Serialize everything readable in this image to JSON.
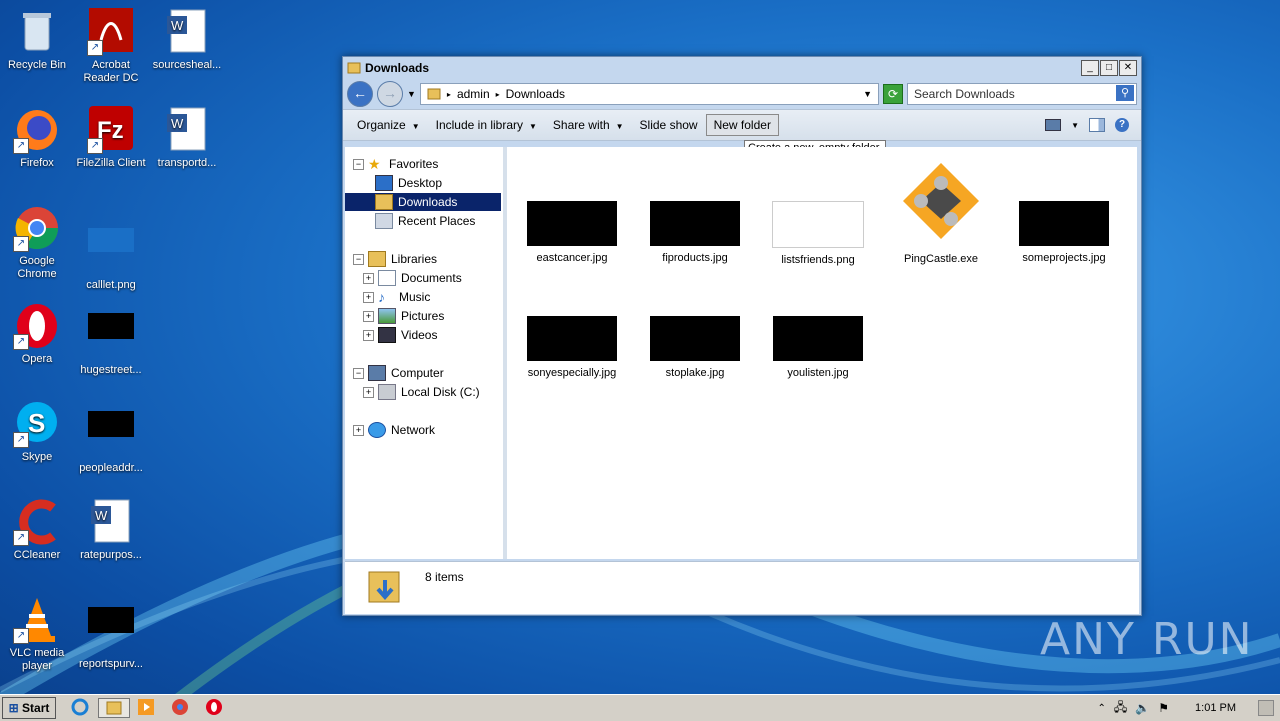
{
  "desktop": {
    "icons": [
      {
        "label": "Recycle Bin"
      },
      {
        "label": "Acrobat Reader DC"
      },
      {
        "label": "sourcesheal..."
      },
      {
        "label": "Firefox"
      },
      {
        "label": "FileZilla Client"
      },
      {
        "label": "transportd..."
      },
      {
        "label": "Google Chrome"
      },
      {
        "label": "calllet.png"
      },
      {
        "label": "Opera"
      },
      {
        "label": "hugestreet..."
      },
      {
        "label": "Skype"
      },
      {
        "label": "peopleaddr..."
      },
      {
        "label": "CCleaner"
      },
      {
        "label": "ratepurpos..."
      },
      {
        "label": "VLC media player"
      },
      {
        "label": "reportspurv..."
      }
    ]
  },
  "window": {
    "title": "Downloads",
    "breadcrumb": [
      "admin",
      "Downloads"
    ],
    "search_placeholder": "Search Downloads",
    "toolbar": {
      "organize": "Organize",
      "include": "Include in library",
      "share": "Share with",
      "slideshow": "Slide show",
      "newfolder": "New folder"
    },
    "tooltip": "Create a new, empty folder.",
    "nav": {
      "favorites": "Favorites",
      "desktop": "Desktop",
      "downloads": "Downloads",
      "recent": "Recent Places",
      "libraries": "Libraries",
      "documents": "Documents",
      "music": "Music",
      "pictures": "Pictures",
      "videos": "Videos",
      "computer": "Computer",
      "localdisk": "Local Disk (C:)",
      "network": "Network"
    },
    "files": [
      {
        "name": "eastcancer.jpg"
      },
      {
        "name": "fiproducts.jpg"
      },
      {
        "name": "listsfriends.png"
      },
      {
        "name": "PingCastle.exe"
      },
      {
        "name": "someprojects.jpg"
      },
      {
        "name": "sonyespecially.jpg"
      },
      {
        "name": "stoplake.jpg"
      },
      {
        "name": "youlisten.jpg"
      }
    ],
    "status": "8 items"
  },
  "taskbar": {
    "start": "Start",
    "clock": "1:01 PM"
  },
  "watermark": "ANY RUN",
  "colors": {
    "selection": "#0a246a",
    "desktop": "#1a6fc6"
  }
}
